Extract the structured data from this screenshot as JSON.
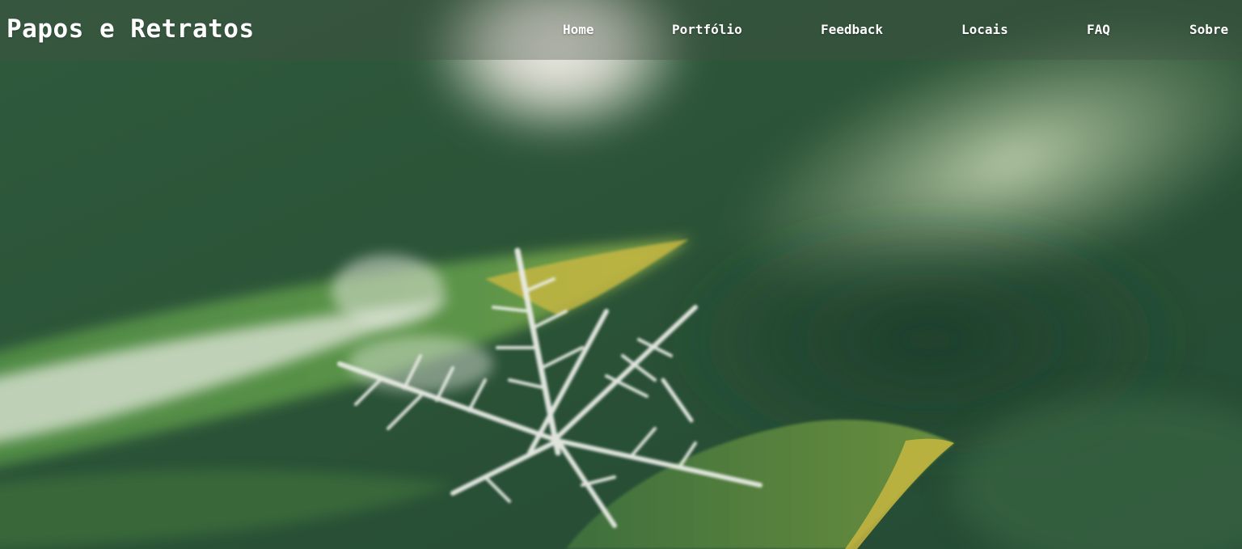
{
  "site": {
    "brand": "Papos e Retratos"
  },
  "nav": {
    "items": [
      {
        "label": "Home"
      },
      {
        "label": "Portfólio"
      },
      {
        "label": "Feedback"
      },
      {
        "label": "Locais"
      },
      {
        "label": "FAQ"
      },
      {
        "label": "Sobre"
      }
    ]
  },
  "theme": {
    "background_dark": "#234a33",
    "background_mid": "#4f7b52",
    "leaf_edge": "#d8c64a",
    "text": "#ffffff"
  }
}
